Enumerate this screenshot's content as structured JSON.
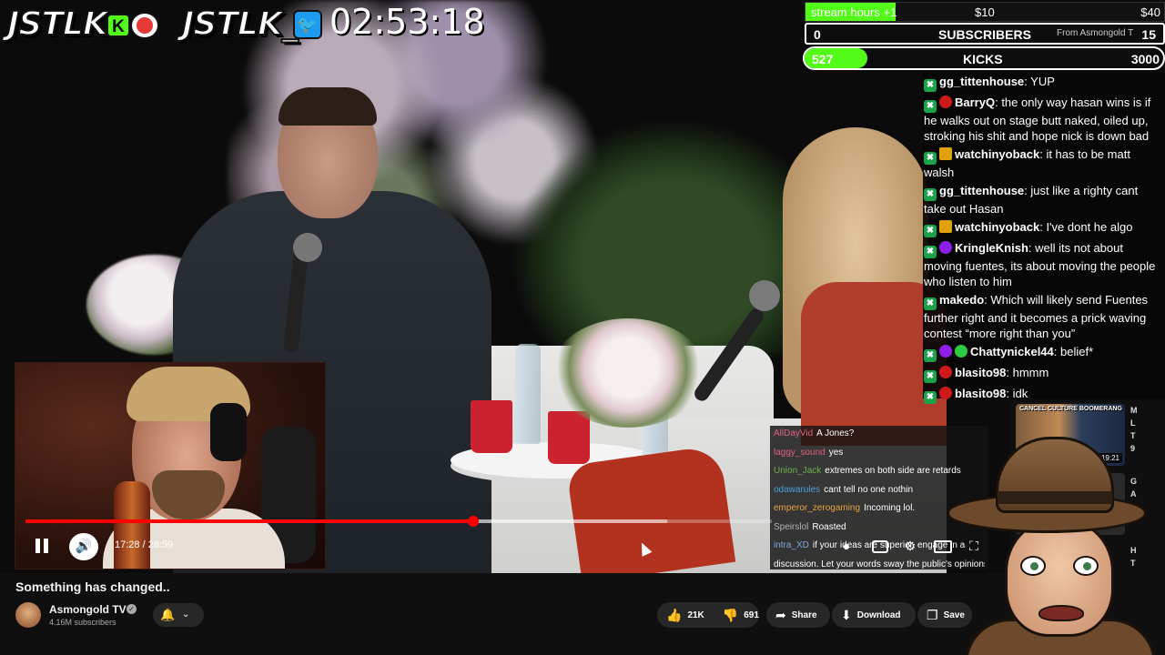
{
  "overlay": {
    "brand_kick": "JSTLK",
    "kick_badge": "K",
    "brand_twitter": "JSTLK_",
    "stream_timer": "02:53:18"
  },
  "goals": {
    "hours_label": "stream hours +1",
    "hours_mid": "$10",
    "hours_max": "$40",
    "hours_progress": 0.25,
    "subs_current": "0",
    "subs_label": "SUBSCRIBERS",
    "subs_from": "From Asmongold T",
    "subs_target": "15",
    "kicks_current": "527",
    "kicks_label": "KICKS",
    "kicks_target": "3000",
    "kicks_progress": 0.176
  },
  "stream_chat": [
    {
      "badges": [
        "mod"
      ],
      "user": "gg_tittenhouse",
      "color": "#ffffff",
      "text": "YUP"
    },
    {
      "badges": [
        "mod",
        "red"
      ],
      "user": "BarryQ",
      "color": "#ffffff",
      "text": "the only way hasan wins is if he walks out on stage butt naked, oiled up, stroking his shit and hope nick is down bad"
    },
    {
      "badges": [
        "mod",
        "crown"
      ],
      "user": "watchinyoback",
      "color": "#ffffff",
      "text": "it has to be matt walsh"
    },
    {
      "badges": [
        "mod"
      ],
      "user": "gg_tittenhouse",
      "color": "#ffffff",
      "text": "just like a righty cant take out Hasan"
    },
    {
      "badges": [
        "mod",
        "crown"
      ],
      "user": "watchinyoback",
      "color": "#ffffff",
      "text": "I've dont he algo"
    },
    {
      "badges": [
        "mod",
        "purple"
      ],
      "user": "KringleKnish",
      "color": "#ffffff",
      "text": "well its not about moving fuentes, its about moving the people who listen to him"
    },
    {
      "badges": [
        "mod"
      ],
      "user": "makedo",
      "color": "#ffffff",
      "text": "Which will likely send Fuentes further right and it becomes a prick waving contest “more right than you”"
    },
    {
      "badges": [
        "mod",
        "purple",
        "clover"
      ],
      "user": "Chattynickel44",
      "color": "#ffffff",
      "text": "belief*"
    },
    {
      "badges": [
        "mod",
        "red"
      ],
      "user": "blasito98",
      "color": "#ffffff",
      "text": "hmmm"
    },
    {
      "badges": [
        "mod",
        "red"
      ],
      "user": "blasito98",
      "color": "#ffffff",
      "text": "idk"
    }
  ],
  "yt_chat": [
    {
      "user": "AllDayVid",
      "text": "A Jones?"
    },
    {
      "user": "laggy_sound",
      "text": "yes"
    },
    {
      "user": "Union_Jack",
      "text": "extremes on both side are retards"
    },
    {
      "user": "odawarules",
      "text": "cant tell no one nothin"
    },
    {
      "user": "emperor_zerogaming",
      "text": "Incoming lol."
    },
    {
      "user": "Speirslol",
      "text": "Roasted"
    },
    {
      "user": "intra_XD",
      "text": "if your ideas are superior, engage in a"
    },
    {
      "user": "",
      "text": "discussion. Let your words sway the public's opinions"
    }
  ],
  "player": {
    "time_display": "17:28 / 28:59",
    "played_fraction": 0.6,
    "buffered_fraction": 0.86
  },
  "video": {
    "title": "Something has changed..",
    "channel_name": "Asmongold TV",
    "subscribers": "4.16M subscribers",
    "likes": "21K",
    "dislikes": "691",
    "share_label": "Share",
    "download_label": "Download",
    "save_label": "Save"
  },
  "sidebar": {
    "thumb_label": "CANCEL CULTURE BOOMERANG",
    "thumb_duration": "19:21",
    "letters": [
      "M",
      "L",
      "T",
      "9",
      "G",
      "A",
      "H",
      "T"
    ]
  },
  "icons": {
    "pause": "pause-icon",
    "volume": "volume-icon",
    "bell": "bell-icon",
    "like": "thumbs-up-icon",
    "dislike": "thumbs-down-icon",
    "share": "share-icon",
    "download": "download-icon",
    "save": "save-icon"
  },
  "colors": {
    "kick_green": "#53fc18",
    "youtube_red": "#ff0000",
    "twitter_blue": "#1d9bf0"
  }
}
